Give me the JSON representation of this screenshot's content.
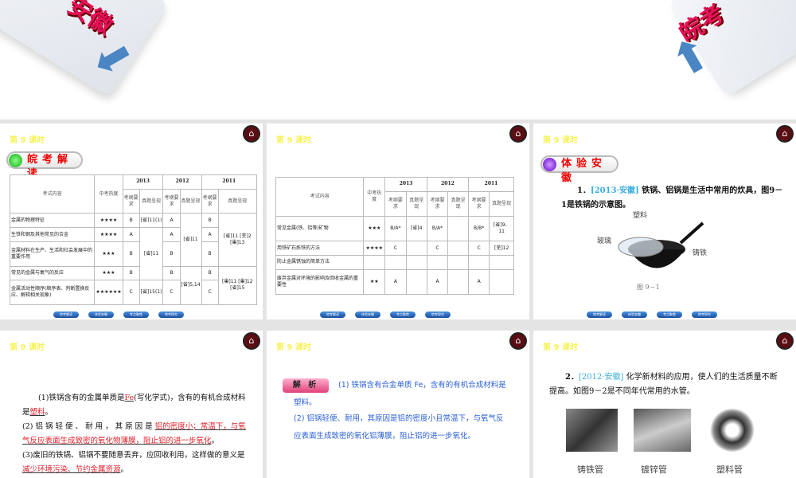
{
  "top": {
    "left_text": "安徽",
    "right_text": "皖考"
  },
  "lesson": "第 9 课时",
  "nav": [
    "皖考解读",
    "体验安徽",
    "考点聚焦",
    "皖考探究"
  ],
  "slide1": {
    "badge": "皖考解读",
    "headers": {
      "content": "考试内容",
      "heat": "中考热度",
      "y2013": "2013",
      "y2012": "2012",
      "y2011": "2011",
      "req": "考纲要求",
      "exam": "真题呈现"
    },
    "rows": [
      [
        "金属的物理特征",
        "★★★★",
        "B",
        "[省]11(1)",
        "A",
        "[省]11",
        "B",
        "[省]11 [芜]2 [巢]13"
      ],
      [
        "生铁和钢及其他常见的合金",
        "★★★★",
        "A",
        "[省]11",
        "A",
        "",
        "A",
        ""
      ],
      [
        "金属材料在生产、生活和社会发展中的重要作用",
        "★★★",
        "B",
        "",
        "B",
        "",
        "B",
        ""
      ],
      [
        "常见的金属与氧气的反应",
        "★★★",
        "B",
        "",
        "B",
        "[省]5,14",
        "B",
        "[巢]11 [巢]12 [省]15"
      ],
      [
        "金属活动性顺序(顺序表、判断置换反应、解释相关现象)",
        "★★★★★★",
        "C",
        "[省]15(1)",
        "C",
        "",
        "C",
        ""
      ]
    ]
  },
  "slide2": {
    "rows": [
      [
        "常见金属(铁、铝等)矿物",
        "★★★",
        "B/A*",
        "[省]4",
        "B/A*",
        "",
        "B/B*",
        "[省]9、11"
      ],
      [
        "用铁矿石炼铁的方法",
        "★★★★",
        "C",
        "",
        "C",
        "",
        "C",
        "[芜]12"
      ],
      [
        "防止金属锈蚀的简单方法",
        "",
        "",
        "",
        "",
        "",
        "",
        ""
      ],
      [
        "废弃金属对环境的影响及回收金属的重要性",
        "★★",
        "A",
        "",
        "A",
        "",
        "A",
        ""
      ]
    ]
  },
  "slide3": {
    "badge": "体验安徽",
    "num": "1．",
    "source": "[2013·安徽]",
    "question": "铁锅、铝锅是生活中常用的炊具，图9－1是铁锅的示意图。",
    "labels": {
      "plastic": "塑料",
      "glass": "玻璃",
      "iron": "铸铁"
    },
    "caption": "图 9－1"
  },
  "slide4": {
    "p1a": "(1)铁锅含有的金属单质是",
    "a1": "Fe",
    "p1b": "(写化学式)，含有的有机合成材料是",
    "a2": "塑料",
    "p1c": "。",
    "p2a": "(2) 铝 锅 轻 便 、 耐 用 ， 其 原 因 是",
    "a3": "铝的密度小；常温下，与氧气反应表面生成致密的氧化物薄膜，阻止铝的进一步氧化",
    "p2b": "。",
    "p3a": "(3)废旧的铁锅、铝锅不要随意丢弃，应回收利用，这样做的意义是",
    "a4": "减少环境污染、节约金属资源",
    "p3b": "。"
  },
  "slide5": {
    "badge": "解 析",
    "t1": "(1) 铁锅含有合金单质 Fe，含有的有机合成材料是塑料。",
    "t2": "(2) 铝锅轻便、耐用，其原因是铝的密度小且常温下，与氧气反应表面生成致密的氧化铝薄膜，阻止铝的进一步氧化。"
  },
  "slide6": {
    "num": "2．",
    "source": "[2012·安徽]",
    "question": "化学新材料的应用，使人们的生活质量不断提高。如图9－2是不同年代常用的水管。",
    "captions": [
      "铸铁管",
      "镀锌管",
      "塑料管"
    ]
  }
}
